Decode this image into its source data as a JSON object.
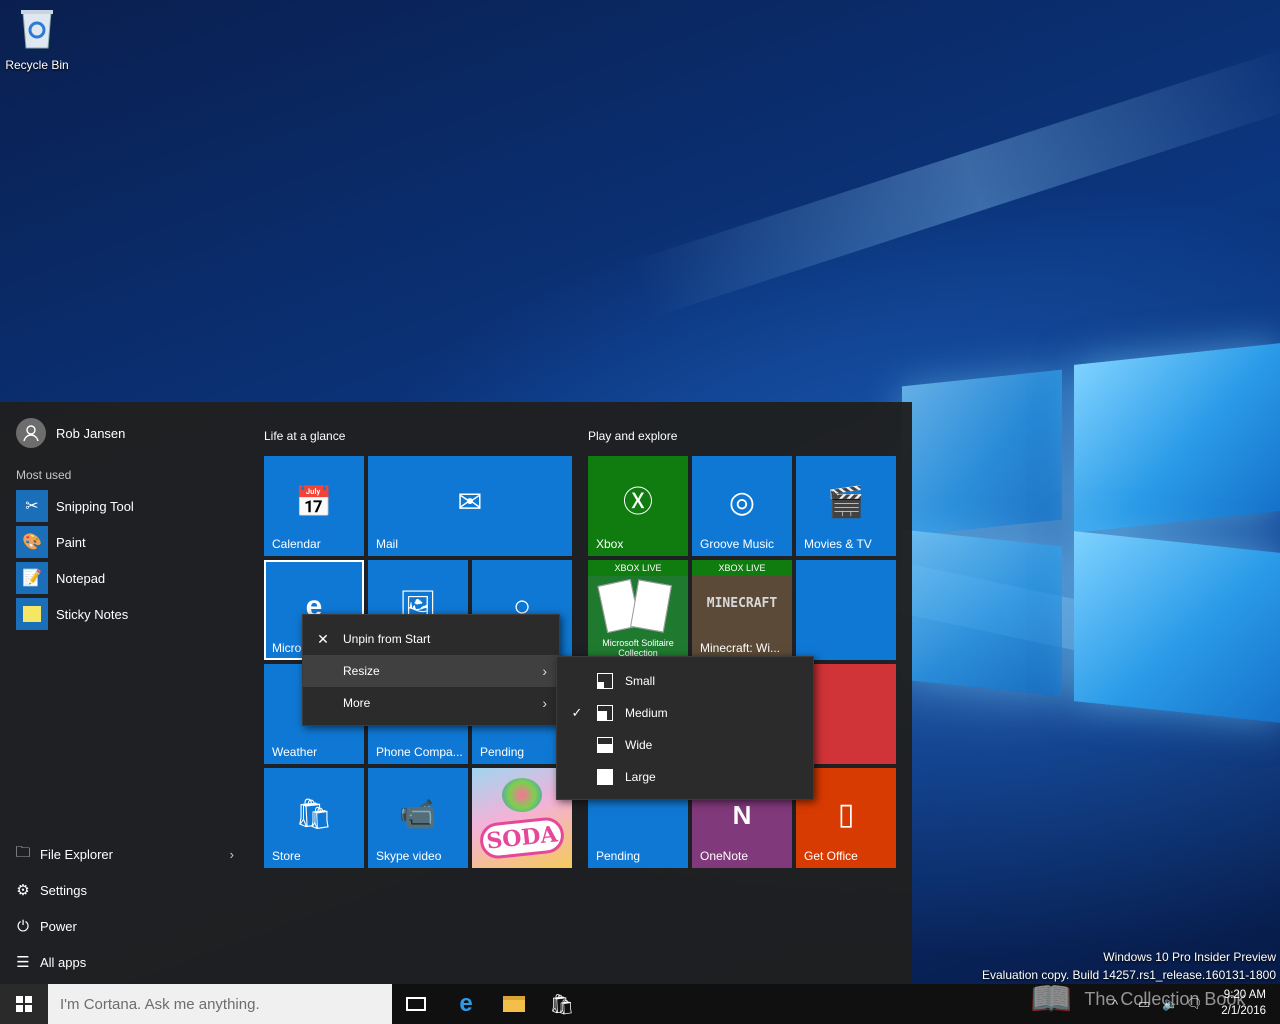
{
  "desktop": {
    "recycle_bin_label": "Recycle Bin",
    "watermark_line1": "Windows 10 Pro Insider Preview",
    "watermark_line2": "Evaluation copy. Build 14257.rs1_release.160131-1800",
    "overlay_logo_text": "The Collection Book"
  },
  "start_menu": {
    "user_name": "Rob Jansen",
    "most_used_title": "Most used",
    "most_used": [
      {
        "label": "Snipping Tool",
        "icon": "scissors-icon"
      },
      {
        "label": "Paint",
        "icon": "palette-icon"
      },
      {
        "label": "Notepad",
        "icon": "notepad-icon"
      },
      {
        "label": "Sticky Notes",
        "icon": "sticky-note-icon"
      }
    ],
    "bottom": [
      {
        "label": "File Explorer",
        "icon": "folder-icon"
      },
      {
        "label": "Settings",
        "icon": "gear-icon"
      },
      {
        "label": "Power",
        "icon": "power-icon"
      },
      {
        "label": "All apps",
        "icon": "list-icon"
      }
    ],
    "groups": {
      "life": "Life at a glance",
      "play": "Play and explore"
    },
    "tiles": {
      "calendar": "Calendar",
      "mail": "Mail",
      "edge": "Micro",
      "weather": "Weather",
      "phone": "Phone Compa...",
      "pending1": "Pending",
      "store": "Store",
      "skype": "Skype video",
      "soda": "SODA",
      "xbox": "Xbox",
      "groove": "Groove Music",
      "movies": "Movies & TV",
      "solitaire_badge": "XBOX LIVE",
      "solitaire_name": "Microsoft Solitaire Collection",
      "minecraft_badge": "XBOX LIVE",
      "minecraft_logo": "MINECRAFT",
      "minecraft": "Minecraft: Wi...",
      "pending2": "Pending",
      "onenote": "OneNote",
      "office": "Get Office"
    }
  },
  "context_menu": {
    "items": [
      {
        "label": "Unpin from Start"
      },
      {
        "label": "Resize"
      },
      {
        "label": "More"
      }
    ]
  },
  "resize_menu": {
    "items": [
      {
        "label": "Small",
        "checked": false
      },
      {
        "label": "Medium",
        "checked": true
      },
      {
        "label": "Wide",
        "checked": false
      },
      {
        "label": "Large",
        "checked": false
      }
    ]
  },
  "taskbar": {
    "search_placeholder": "I'm Cortana. Ask me anything.",
    "time": "9:20 AM",
    "date": "2/1/2016"
  },
  "colors": {
    "tile_blue": "#0f78d4",
    "xbox_green": "#107c10",
    "onenote_purple": "#80397b",
    "office_orange": "#d83b01",
    "red_tile": "#d13438"
  }
}
